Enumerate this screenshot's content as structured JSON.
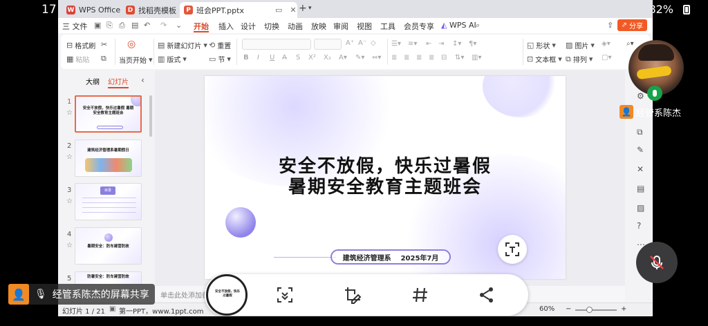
{
  "status": {
    "time": "17",
    "battery": "82%"
  },
  "tabs": [
    {
      "label": "WPS Office",
      "icon": "W",
      "color": "#d8453a"
    },
    {
      "label": "找稻壳模板",
      "icon": "D",
      "color": "#e14a33"
    },
    {
      "label": "班会PPT.pptx",
      "icon": "P",
      "color": "#e0583b"
    }
  ],
  "menu": {
    "file": "三 文件",
    "items": [
      "开始",
      "插入",
      "设计",
      "切换",
      "动画",
      "放映",
      "审阅",
      "视图",
      "工具",
      "会员专享"
    ],
    "wps_ai": "WPS AI",
    "share": "分享"
  },
  "ribbon": {
    "format_painter": "格式刷",
    "paste": "粘贴",
    "from_current": "当页开始",
    "new_slide": "新建幻灯片",
    "reset": "重置",
    "layout": "版式",
    "section": "节",
    "shape": "形状",
    "picture": "图片",
    "textbox": "文本框",
    "arrange": "排列"
  },
  "leftpane": {
    "tab_outline": "大纲",
    "tab_slides": "幻灯片",
    "slides": [
      {
        "num": "1",
        "text": "安全不放假，快乐过暑假 暑期安全教育主题班会"
      },
      {
        "num": "2",
        "text": "建筑经济管理系暑期假日"
      },
      {
        "num": "3",
        "text": "目录"
      },
      {
        "num": "4",
        "text": "暑期安全：防车建营防故"
      },
      {
        "num": "5",
        "text": "防暑安全：防车建营防故"
      }
    ]
  },
  "slide": {
    "title_line1": "安全不放假，快乐过暑假",
    "title_line2": "暑期安全教育主题班会",
    "department": "建筑经济管理系",
    "date": "2025年7月"
  },
  "notes_placeholder": "单击此处添加备注",
  "statusline": {
    "slide_counter": "幻灯片 1 / 21",
    "theme": "第一PPT，www.1ppt.com",
    "zoom": "60%"
  },
  "overlay": {
    "participant_name": "经管系陈杰",
    "screen_share_label": "经管系陈杰的屏幕共享"
  }
}
